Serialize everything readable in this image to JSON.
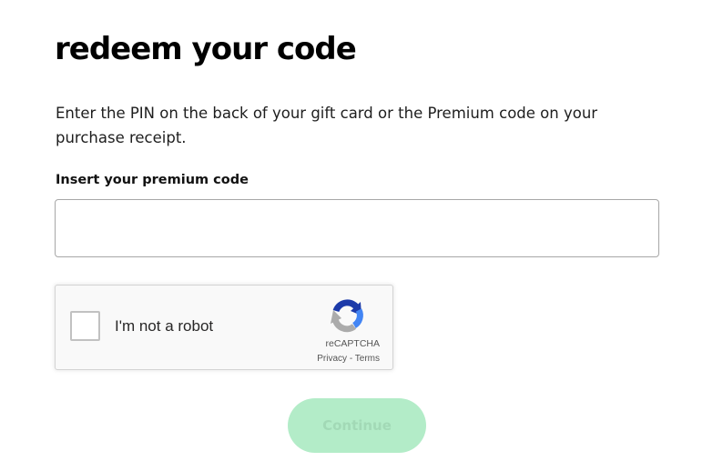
{
  "header": {
    "title": "redeem your code"
  },
  "main": {
    "description": "Enter the PIN on the back of your gift card or the Premium code on your purchase receipt.",
    "code_field": {
      "label": "Insert your premium code",
      "value": "",
      "placeholder": ""
    },
    "recaptcha": {
      "checkbox_label": "I'm not a robot",
      "checked": false,
      "brand": "reCAPTCHA",
      "privacy_link": "Privacy",
      "separator": " - ",
      "terms_link": "Terms",
      "icon": "recaptcha-logo-icon"
    },
    "continue_button": {
      "label": "Continue",
      "enabled": false
    }
  },
  "colors": {
    "button_bg": "#b3ecc8",
    "button_text": "#a2d9b6",
    "input_border": "#a7a7a7",
    "recaptcha_bg": "#f9f9f9"
  }
}
